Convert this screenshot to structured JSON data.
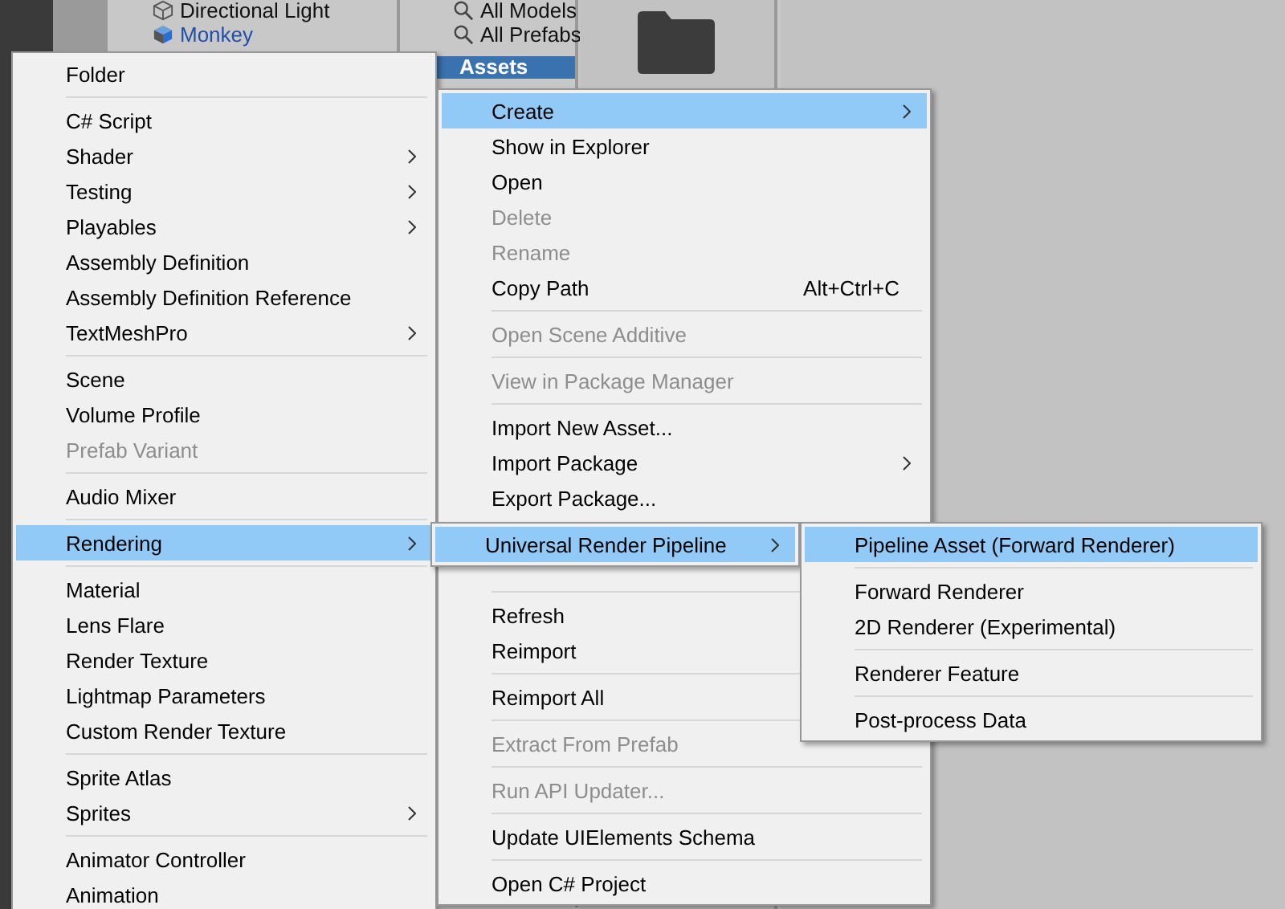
{
  "hierarchy": {
    "items": [
      {
        "label": "Directional Light",
        "kind": "object"
      },
      {
        "label": "Monkey",
        "kind": "prefab"
      }
    ]
  },
  "project": {
    "favorites": [
      {
        "label": "All Models"
      },
      {
        "label": "All Prefabs"
      }
    ],
    "tree": [
      {
        "label": "Assets",
        "selected": true
      }
    ]
  },
  "menus": [
    {
      "items": [
        {
          "kind": "item",
          "label": "Folder",
          "selected": false,
          "disabled": false
        },
        {
          "kind": "separator"
        },
        {
          "kind": "item",
          "label": "C# Script",
          "selected": false,
          "disabled": false
        },
        {
          "kind": "item",
          "label": "Shader",
          "selected": false,
          "disabled": false,
          "submenu": true
        },
        {
          "kind": "item",
          "label": "Testing",
          "selected": false,
          "disabled": false,
          "submenu": true
        },
        {
          "kind": "item",
          "label": "Playables",
          "selected": false,
          "disabled": false,
          "submenu": true
        },
        {
          "kind": "item",
          "label": "Assembly Definition",
          "selected": false,
          "disabled": false
        },
        {
          "kind": "item",
          "label": "Assembly Definition Reference",
          "selected": false,
          "disabled": false
        },
        {
          "kind": "item",
          "label": "TextMeshPro",
          "selected": false,
          "disabled": false,
          "submenu": true
        },
        {
          "kind": "separator"
        },
        {
          "kind": "item",
          "label": "Scene",
          "selected": false,
          "disabled": false
        },
        {
          "kind": "item",
          "label": "Volume Profile",
          "selected": false,
          "disabled": false
        },
        {
          "kind": "item",
          "label": "Prefab Variant",
          "selected": false,
          "disabled": true
        },
        {
          "kind": "separator"
        },
        {
          "kind": "item",
          "label": "Audio Mixer",
          "selected": false,
          "disabled": false
        },
        {
          "kind": "separator"
        },
        {
          "kind": "item",
          "label": "Rendering",
          "selected": true,
          "disabled": false,
          "submenu": true
        },
        {
          "kind": "separator"
        },
        {
          "kind": "item",
          "label": "Material",
          "selected": false,
          "disabled": false
        },
        {
          "kind": "item",
          "label": "Lens Flare",
          "selected": false,
          "disabled": false
        },
        {
          "kind": "item",
          "label": "Render Texture",
          "selected": false,
          "disabled": false
        },
        {
          "kind": "item",
          "label": "Lightmap Parameters",
          "selected": false,
          "disabled": false
        },
        {
          "kind": "item",
          "label": "Custom Render Texture",
          "selected": false,
          "disabled": false
        },
        {
          "kind": "separator"
        },
        {
          "kind": "item",
          "label": "Sprite Atlas",
          "selected": false,
          "disabled": false
        },
        {
          "kind": "item",
          "label": "Sprites",
          "selected": false,
          "disabled": false,
          "submenu": true
        },
        {
          "kind": "separator"
        },
        {
          "kind": "item",
          "label": "Animator Controller",
          "selected": false,
          "disabled": false
        },
        {
          "kind": "item",
          "label": "Animation",
          "selected": false,
          "disabled": false
        }
      ]
    },
    {
      "items": [
        {
          "kind": "item",
          "label": "Create",
          "selected": true,
          "disabled": false,
          "submenu": true
        },
        {
          "kind": "item",
          "label": "Show in Explorer",
          "selected": false,
          "disabled": false
        },
        {
          "kind": "item",
          "label": "Open",
          "selected": false,
          "disabled": false
        },
        {
          "kind": "item",
          "label": "Delete",
          "selected": false,
          "disabled": true
        },
        {
          "kind": "item",
          "label": "Rename",
          "selected": false,
          "disabled": true
        },
        {
          "kind": "item",
          "label": "Copy Path",
          "shortcut": "Alt+Ctrl+C",
          "selected": false,
          "disabled": false
        },
        {
          "kind": "separator"
        },
        {
          "kind": "item",
          "label": "Open Scene Additive",
          "selected": false,
          "disabled": true
        },
        {
          "kind": "separator"
        },
        {
          "kind": "item",
          "label": "View in Package Manager",
          "selected": false,
          "disabled": true
        },
        {
          "kind": "separator"
        },
        {
          "kind": "item",
          "label": "Import New Asset...",
          "selected": false,
          "disabled": false
        },
        {
          "kind": "item",
          "label": "Import Package",
          "selected": false,
          "disabled": false,
          "submenu": true
        },
        {
          "kind": "item",
          "label": "Export Package...",
          "selected": false,
          "disabled": false
        },
        {
          "kind": "separator"
        },
        {
          "kind": "item",
          "label": "Refresh",
          "selected": false,
          "disabled": false
        },
        {
          "kind": "item",
          "label": "Reimport",
          "selected": false,
          "disabled": false
        },
        {
          "kind": "separator"
        },
        {
          "kind": "item",
          "label": "Reimport All",
          "selected": false,
          "disabled": false
        },
        {
          "kind": "separator"
        },
        {
          "kind": "item",
          "label": "Extract From Prefab",
          "selected": false,
          "disabled": true
        },
        {
          "kind": "separator"
        },
        {
          "kind": "item",
          "label": "Run API Updater...",
          "selected": false,
          "disabled": true
        },
        {
          "kind": "separator"
        },
        {
          "kind": "item",
          "label": "Update UIElements Schema",
          "selected": false,
          "disabled": false
        },
        {
          "kind": "separator"
        },
        {
          "kind": "item",
          "label": "Open C# Project",
          "selected": false,
          "disabled": false
        }
      ]
    },
    {
      "items": [
        {
          "kind": "item",
          "label": "Universal Render Pipeline",
          "selected": true,
          "disabled": false,
          "submenu": true
        }
      ]
    },
    {
      "items": [
        {
          "kind": "item",
          "label": "Pipeline Asset (Forward Renderer)",
          "selected": true,
          "disabled": false
        },
        {
          "kind": "separator"
        },
        {
          "kind": "item",
          "label": "Forward Renderer",
          "selected": false,
          "disabled": false
        },
        {
          "kind": "item",
          "label": "2D Renderer (Experimental)",
          "selected": false,
          "disabled": false
        },
        {
          "kind": "separator"
        },
        {
          "kind": "item",
          "label": "Renderer Feature",
          "selected": false,
          "disabled": false
        },
        {
          "kind": "separator"
        },
        {
          "kind": "item",
          "label": "Post-process Data",
          "selected": false,
          "disabled": false
        }
      ]
    }
  ]
}
